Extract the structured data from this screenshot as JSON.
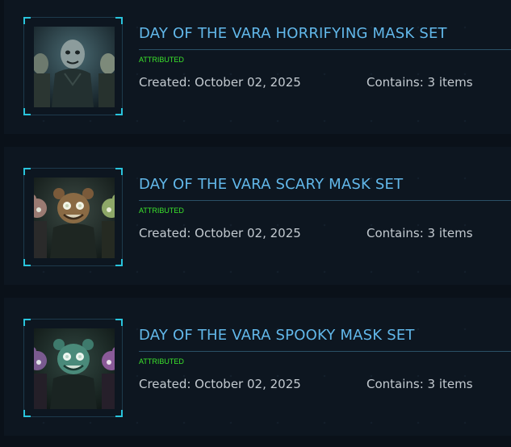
{
  "items": [
    {
      "title": "DAY OF THE VARA HORRIFYING MASK SET",
      "badge": "ATTRIBUTED",
      "created": "Created: October 02, 2025",
      "contains": "Contains: 3 items",
      "thumbnail": "horrifying-mask-set-thumbnail"
    },
    {
      "title": "DAY OF THE VARA SCARY MASK SET",
      "badge": "ATTRIBUTED",
      "created": "Created: October 02, 2025",
      "contains": "Contains: 3 items",
      "thumbnail": "scary-mask-set-thumbnail"
    },
    {
      "title": "DAY OF THE VARA SPOOKY MASK SET",
      "badge": "ATTRIBUTED",
      "created": "Created: October 02, 2025",
      "contains": "Contains: 3 items",
      "thumbnail": "spooky-mask-set-thumbnail"
    }
  ],
  "colors": {
    "title": "#62b8ea",
    "badge": "#3ce52c",
    "meta_text": "#c3cad0",
    "frame_corner": "#29c4dc",
    "card_background": "#0d1620",
    "page_background": "#0a1119"
  }
}
